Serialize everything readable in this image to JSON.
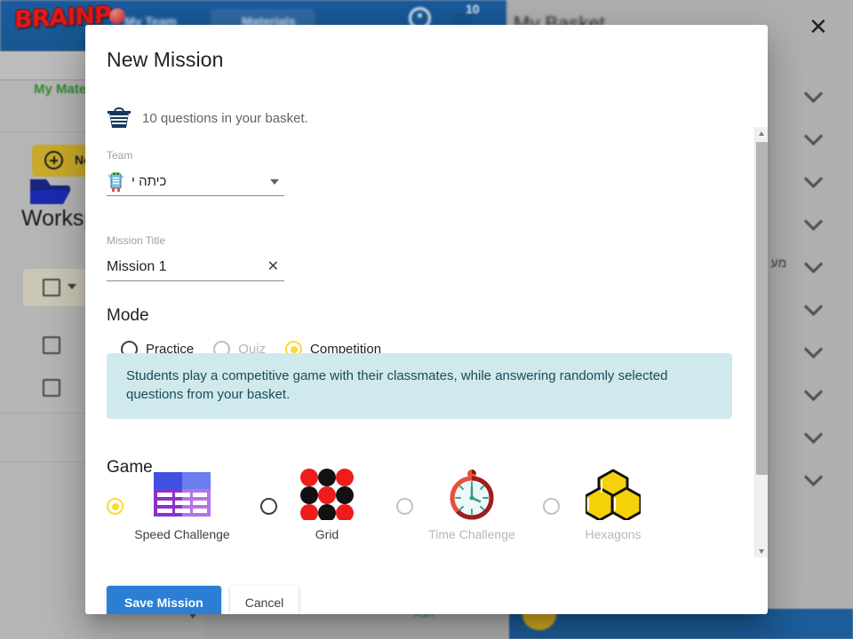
{
  "background": {
    "logo_text": "BRAINP",
    "nav_items": [
      "My Team",
      "Materials"
    ],
    "basket_badge": "10",
    "panel_title": "My Basket",
    "close_icon": "close-icon",
    "tab_label": "My Materials",
    "new_button_label": "New",
    "workspace_title": "Workspace",
    "hebrew_snippets": [
      "?",
      "מע ..."
    ],
    "footer_link": "הבא"
  },
  "dialog": {
    "title": "New Mission",
    "basket": {
      "icon": "basket-icon",
      "text": "10 questions in your basket."
    },
    "team": {
      "label": "Team",
      "value": "כיתה י",
      "avatar_icon": "robot-avatar-icon",
      "caret_icon": "chevron-down-icon"
    },
    "mission_title": {
      "label": "Mission Title",
      "value": "Mission 1",
      "placeholder": "Mission Title",
      "clear_icon": "close-icon"
    },
    "mode": {
      "heading": "Mode",
      "options": [
        {
          "label": "Practice",
          "selected": false,
          "disabled": false
        },
        {
          "label": "Quiz",
          "selected": false,
          "disabled": true
        },
        {
          "label": "Competition",
          "selected": true,
          "disabled": false
        }
      ]
    },
    "info": {
      "text": "Students play a competitive game with their classmates, while answering randomly selected questions from your basket.",
      "bg_color": "#cfe9ec",
      "text_color": "#1b4b5c"
    },
    "game": {
      "heading": "Game",
      "options": [
        {
          "label": "Speed Challenge",
          "icon": "table-grid-icon",
          "selected": true,
          "disabled": false
        },
        {
          "label": "Grid",
          "icon": "dot-grid-icon",
          "selected": false,
          "disabled": false
        },
        {
          "label": "Time Challenge",
          "icon": "stopwatch-icon",
          "selected": false,
          "disabled": true
        },
        {
          "label": "Hexagons",
          "icon": "honeycomb-icon",
          "selected": false,
          "disabled": true
        }
      ]
    },
    "buttons": {
      "save_label": "Save Mission",
      "cancel_label": "Cancel",
      "save_color": "#2a7fd4"
    },
    "accent_color": "#fdd835"
  }
}
